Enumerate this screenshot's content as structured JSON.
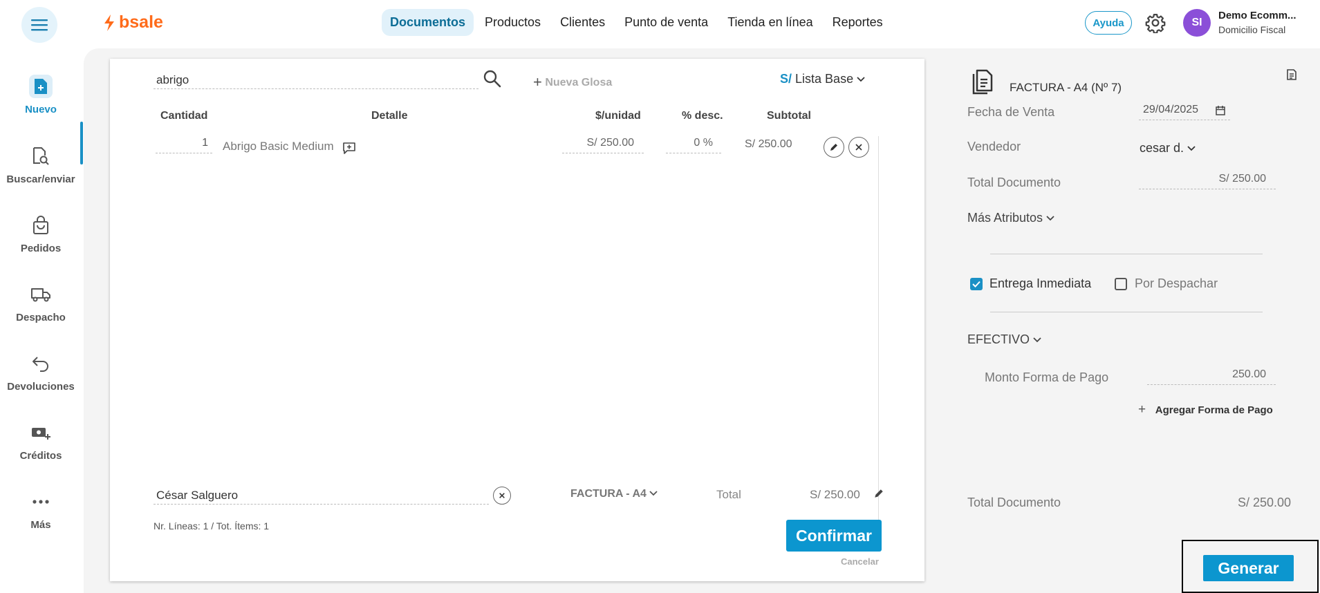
{
  "brand": {
    "name": "bsale",
    "color": "#ff6b1a",
    "accent": "#0c96cf"
  },
  "nav": {
    "items": [
      "Documentos",
      "Productos",
      "Clientes",
      "Punto de venta",
      "Tienda en línea",
      "Reportes"
    ],
    "active": "Documentos"
  },
  "header": {
    "help_label": "Ayuda",
    "avatar_initials": "SI",
    "user_name": "Demo Ecomm...",
    "user_sub": "Domicilio Fiscal"
  },
  "sidebar": {
    "items": [
      {
        "label": "Nuevo",
        "icon": "new-document-icon"
      },
      {
        "label": "Buscar/enviar",
        "icon": "search-document-icon"
      },
      {
        "label": "Pedidos",
        "icon": "bag-icon"
      },
      {
        "label": "Despacho",
        "icon": "truck-icon"
      },
      {
        "label": "Devoluciones",
        "icon": "return-arrow-icon"
      },
      {
        "label": "Créditos",
        "icon": "money-plus-icon"
      },
      {
        "label": "Más",
        "icon": "more-dots-icon"
      }
    ]
  },
  "editor": {
    "search_value": "abrigo",
    "new_glosa_label": "Nueva Glosa",
    "price_list_currency": "S/",
    "price_list_label": "Lista Base",
    "columns": {
      "qty": "Cantidad",
      "detail": "Detalle",
      "unit_price": "$/unidad",
      "discount": "% desc.",
      "subtotal": "Subtotal"
    },
    "line": {
      "qty": "1",
      "detail": "Abrigo Basic Medium",
      "unit_price": "S/ 250.00",
      "discount": "0 %",
      "subtotal": "S/ 250.00"
    },
    "client_value": "César Salguero",
    "doc_type": "FACTURA - A4",
    "total_label": "Total",
    "total_value": "S/ 250.00",
    "lines_info": "Nr. Líneas: 1 / Tot. Ítems: 1",
    "confirm_label": "Confirmar",
    "cancel_label": "Cancelar"
  },
  "panel": {
    "doc_title": "FACTURA - A4 (Nº 7)",
    "sale_date_label": "Fecha de Venta",
    "sale_date_value": "29/04/2025",
    "seller_label": "Vendedor",
    "seller_value": "cesar d.",
    "total_doc_label": "Total Documento",
    "total_doc_value": "S/ 250.00",
    "more_attrs_label": "Más Atributos",
    "immediate_label": "Entrega Inmediata",
    "immediate_checked": true,
    "dispatch_label": "Por Despachar",
    "dispatch_checked": false,
    "payment_method": "EFECTIVO",
    "payment_amount_label": "Monto Forma de Pago",
    "payment_amount_value": "250.00",
    "add_payment_label": "Agregar Forma de Pago",
    "footer_total_label": "Total Documento",
    "footer_total_value": "S/ 250.00",
    "generate_label": "Generar"
  }
}
